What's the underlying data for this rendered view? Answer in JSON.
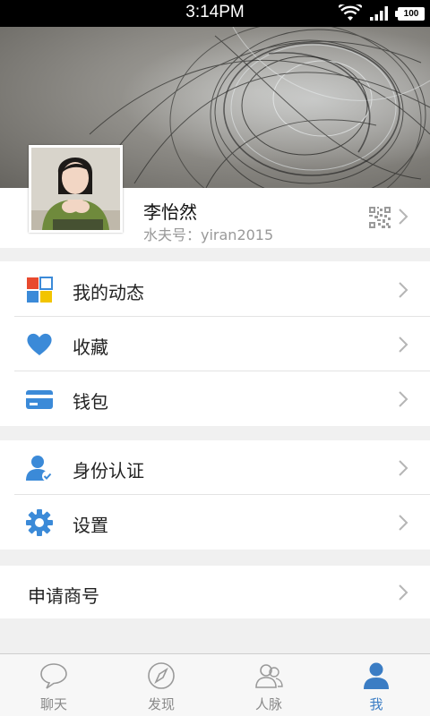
{
  "status_bar": {
    "time": "3:14PM",
    "battery": "100"
  },
  "profile": {
    "name": "李怡然",
    "id_text": "水夫号：yiran2015"
  },
  "menu_groups": [
    {
      "items": [
        {
          "label": "我的动态",
          "icon": "grid-squares-icon"
        },
        {
          "label": "收藏",
          "icon": "heart-icon"
        },
        {
          "label": "钱包",
          "icon": "wallet-card-icon"
        }
      ]
    },
    {
      "items": [
        {
          "label": "身份认证",
          "icon": "verified-user-icon"
        },
        {
          "label": "设置",
          "icon": "gear-icon"
        }
      ]
    },
    {
      "items": [
        {
          "label": "申请商号",
          "icon": ""
        }
      ]
    }
  ],
  "tabs": [
    {
      "label": "聊天",
      "icon": "chat-bubble-icon",
      "active": false
    },
    {
      "label": "发现",
      "icon": "compass-icon",
      "active": false
    },
    {
      "label": "人脉",
      "icon": "contacts-icon",
      "active": false
    },
    {
      "label": "我",
      "icon": "user-icon",
      "active": true
    }
  ],
  "colors": {
    "accent": "#3b7dc4",
    "grid_red": "#e84a2f",
    "grid_blue": "#3b8ad8",
    "grid_yellow": "#f2c400"
  }
}
